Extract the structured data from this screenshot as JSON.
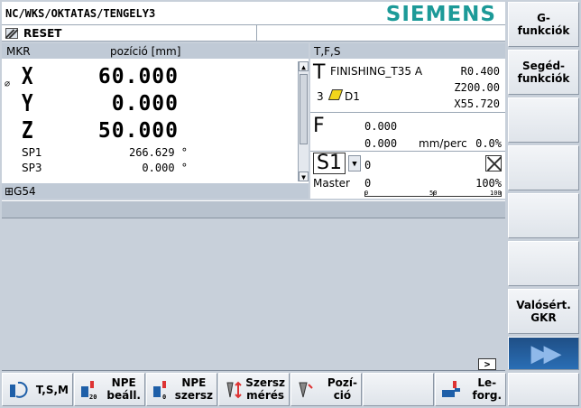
{
  "header": {
    "path": "NC/WKS/OKTATAS/TENGELY3",
    "logo": "SIEMENS"
  },
  "status": {
    "text": "RESET"
  },
  "mkr": {
    "caption": "MKR",
    "column": "pozíció [mm]",
    "axes": [
      {
        "name": "X",
        "value": "60.000"
      },
      {
        "name": "Y",
        "value": "0.000"
      },
      {
        "name": "Z",
        "value": "50.000"
      }
    ],
    "spindles": [
      {
        "name": "SP1",
        "value": "266.629 °"
      },
      {
        "name": "SP3",
        "value": "0.000 °"
      }
    ],
    "frame": "G54"
  },
  "tfs": {
    "caption": "T,F,S",
    "tool_letter": "T",
    "tool_name": "FINISHING_T35 A",
    "radius": "R0.400",
    "z_offset": "Z200.00",
    "x_offset": "X55.720",
    "edge_no": "3",
    "d_no": "D1",
    "feed_letter": "F",
    "feed_1": "0.000",
    "feed_2": "0.000",
    "feed_unit": "mm/perc",
    "feed_pct": "0.0%",
    "spindle_name": "S1",
    "spindle_value": "0",
    "spindle_mode": "Master",
    "spindle_speed": "0",
    "spindle_pct": "100%",
    "scale": [
      "0",
      "50",
      "100"
    ]
  },
  "nav": {
    "more": ">"
  },
  "vsoftkeys": [
    {
      "label": "G-\nfunkciók"
    },
    {
      "label": "Segéd-\nfunkciók"
    },
    {
      "label": ""
    },
    {
      "label": ""
    },
    {
      "label": ""
    },
    {
      "label": ""
    },
    {
      "label": "Valósért.\nGKR"
    },
    {
      "label": "▶▶"
    }
  ],
  "hsoftkeys": [
    {
      "label": "T,S,M"
    },
    {
      "label": "NPE\nbeáll."
    },
    {
      "label": "NPE\nszersz"
    },
    {
      "label": "Szersz\nmérés"
    },
    {
      "label": "Pozí-\nció"
    },
    {
      "label": ""
    },
    {
      "label": "Le-\nforg."
    },
    {
      "label": ""
    }
  ]
}
